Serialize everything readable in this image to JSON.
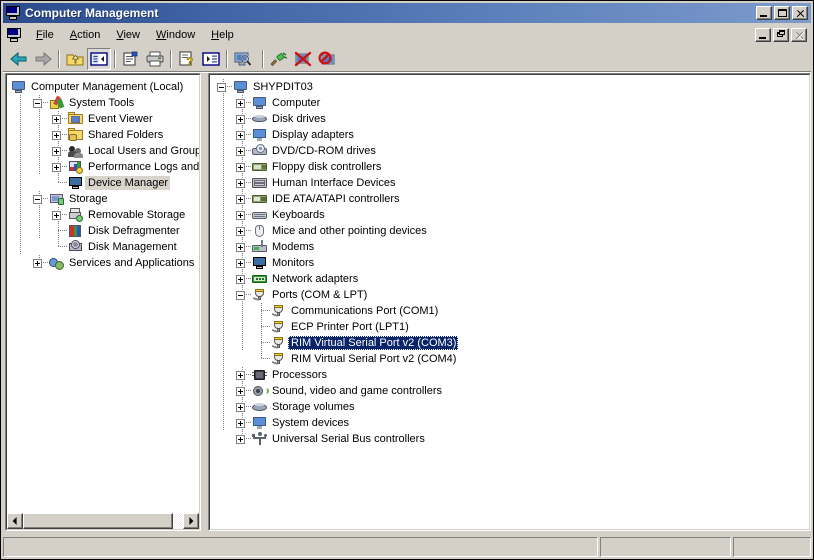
{
  "window": {
    "title": "Computer Management",
    "title_icon": "computer-icon",
    "buttons": {
      "minimize": "minimize-icon",
      "maximize": "maximize-icon",
      "close": "close-icon"
    }
  },
  "mdi": {
    "buttons": {
      "minimize": "minimize-icon",
      "restore": "restore-icon",
      "close": "close-icon-disabled"
    }
  },
  "menu": {
    "system_icon": "console-icon",
    "items": [
      {
        "label": "File",
        "accel": "F"
      },
      {
        "label": "Action",
        "accel": "A"
      },
      {
        "label": "View",
        "accel": "V"
      },
      {
        "label": "Window",
        "accel": "W"
      },
      {
        "label": "Help",
        "accel": "H"
      }
    ]
  },
  "toolbar": {
    "buttons": [
      {
        "name": "back-button",
        "icon": "left-arrow-icon",
        "enabled": true,
        "pressed": false
      },
      {
        "name": "forward-button",
        "icon": "right-arrow-icon",
        "enabled": false,
        "pressed": false
      },
      {
        "name": "up-one-level-button",
        "icon": "up-folder-icon",
        "enabled": true,
        "pressed": false
      },
      {
        "name": "show-hide-tree-button",
        "icon": "console-tree-icon",
        "enabled": true,
        "pressed": true
      },
      {
        "name": "properties-button",
        "icon": "properties-icon",
        "enabled": true,
        "pressed": false
      },
      {
        "name": "print-button",
        "icon": "printer-icon",
        "enabled": true,
        "pressed": false
      },
      {
        "name": "help-button",
        "icon": "help-document-icon",
        "enabled": true,
        "pressed": false
      },
      {
        "name": "show-details-button",
        "icon": "details-pane-icon",
        "enabled": true,
        "pressed": false
      },
      {
        "name": "scan-hardware-changes-button",
        "icon": "scan-hardware-icon",
        "enabled": true,
        "pressed": false
      },
      {
        "name": "update-driver-button",
        "icon": "update-driver-icon",
        "enabled": true,
        "pressed": false
      },
      {
        "name": "uninstall-device-button",
        "icon": "uninstall-red-x-icon",
        "enabled": true,
        "pressed": false
      },
      {
        "name": "disable-device-button",
        "icon": "disable-prohibition-icon",
        "enabled": true,
        "pressed": false
      }
    ]
  },
  "console_tree": {
    "root": {
      "label": "Computer Management (Local)",
      "icon": "computer-icon"
    },
    "nodes": [
      {
        "label": "System Tools",
        "icon": "system-tools-icon",
        "depth": 1,
        "expander": "minus",
        "selected": false
      },
      {
        "label": "Event Viewer",
        "icon": "event-viewer-icon",
        "depth": 2,
        "expander": "plus",
        "selected": false
      },
      {
        "label": "Shared Folders",
        "icon": "shared-folders-icon",
        "depth": 2,
        "expander": "plus",
        "selected": false
      },
      {
        "label": "Local Users and Groups",
        "icon": "local-users-icon",
        "depth": 2,
        "expander": "plus",
        "selected": false
      },
      {
        "label": "Performance Logs and Alerts",
        "icon": "performance-logs-icon",
        "depth": 2,
        "expander": "plus",
        "selected": false
      },
      {
        "label": "Device Manager",
        "icon": "device-manager-icon",
        "depth": 2,
        "expander": "leaf",
        "selected": true
      },
      {
        "label": "Storage",
        "icon": "storage-icon",
        "depth": 1,
        "expander": "minus",
        "selected": false
      },
      {
        "label": "Removable Storage",
        "icon": "removable-storage-icon",
        "depth": 2,
        "expander": "plus",
        "selected": false
      },
      {
        "label": "Disk Defragmenter",
        "icon": "disk-defrag-icon",
        "depth": 2,
        "expander": "leaf",
        "selected": false
      },
      {
        "label": "Disk Management",
        "icon": "disk-management-icon",
        "depth": 2,
        "expander": "leaf",
        "selected": false
      },
      {
        "label": "Services and Applications",
        "icon": "services-apps-icon",
        "depth": 1,
        "expander": "plus",
        "selected": false
      }
    ]
  },
  "device_tree": {
    "root": {
      "label": "SHYPDIT03",
      "icon": "computer-node-icon",
      "expander": "minus"
    },
    "nodes": [
      {
        "label": "Computer",
        "icon": "computer-category-icon",
        "depth": 1,
        "expander": "plus",
        "selected": false
      },
      {
        "label": "Disk drives",
        "icon": "disk-drive-icon",
        "depth": 1,
        "expander": "plus",
        "selected": false
      },
      {
        "label": "Display adapters",
        "icon": "display-adapter-icon",
        "depth": 1,
        "expander": "plus",
        "selected": false
      },
      {
        "label": "DVD/CD-ROM drives",
        "icon": "dvd-drive-icon",
        "depth": 1,
        "expander": "plus",
        "selected": false
      },
      {
        "label": "Floppy disk controllers",
        "icon": "floppy-controller-icon",
        "depth": 1,
        "expander": "plus",
        "selected": false
      },
      {
        "label": "Human Interface Devices",
        "icon": "hid-icon",
        "depth": 1,
        "expander": "plus",
        "selected": false
      },
      {
        "label": "IDE ATA/ATAPI controllers",
        "icon": "ide-controller-icon",
        "depth": 1,
        "expander": "plus",
        "selected": false
      },
      {
        "label": "Keyboards",
        "icon": "keyboard-icon",
        "depth": 1,
        "expander": "plus",
        "selected": false
      },
      {
        "label": "Mice and other pointing devices",
        "icon": "mouse-icon",
        "depth": 1,
        "expander": "plus",
        "selected": false
      },
      {
        "label": "Modems",
        "icon": "modem-icon",
        "depth": 1,
        "expander": "plus",
        "selected": false
      },
      {
        "label": "Monitors",
        "icon": "monitor-icon",
        "depth": 1,
        "expander": "plus",
        "selected": false
      },
      {
        "label": "Network adapters",
        "icon": "network-adapter-icon",
        "depth": 1,
        "expander": "plus",
        "selected": false
      },
      {
        "label": "Ports (COM & LPT)",
        "icon": "port-icon",
        "depth": 1,
        "expander": "minus",
        "selected": false
      },
      {
        "label": "Communications Port (COM1)",
        "icon": "port-icon",
        "depth": 2,
        "expander": "leaf",
        "selected": false
      },
      {
        "label": "ECP Printer Port (LPT1)",
        "icon": "port-icon",
        "depth": 2,
        "expander": "leaf",
        "selected": false
      },
      {
        "label": "RIM Virtual Serial Port v2 (COM3)",
        "icon": "port-icon",
        "depth": 2,
        "expander": "leaf",
        "selected": true
      },
      {
        "label": "RIM Virtual Serial Port v2 (COM4)",
        "icon": "port-icon",
        "depth": 2,
        "expander": "leaf",
        "selected": false
      },
      {
        "label": "Processors",
        "icon": "processor-icon",
        "depth": 1,
        "expander": "plus",
        "selected": false
      },
      {
        "label": "Sound, video and game controllers",
        "icon": "sound-controller-icon",
        "depth": 1,
        "expander": "plus",
        "selected": false
      },
      {
        "label": "Storage volumes",
        "icon": "storage-volume-icon",
        "depth": 1,
        "expander": "plus",
        "selected": false
      },
      {
        "label": "System devices",
        "icon": "system-device-icon",
        "depth": 1,
        "expander": "plus",
        "selected": false
      },
      {
        "label": "Universal Serial Bus controllers",
        "icon": "usb-controller-icon",
        "depth": 1,
        "expander": "plus",
        "selected": false
      }
    ]
  },
  "left_scrollbar": {
    "left_arrow": "scroll-left-arrow-icon",
    "right_arrow": "scroll-right-arrow-icon",
    "thumb_percent": 94
  },
  "statusbar": {
    "panes": [
      "",
      "",
      ""
    ]
  },
  "colors": {
    "title_gradient_start": "#2b4a8b",
    "title_gradient_end": "#7d9bcc",
    "face": "#d4d0c8",
    "selection_active": "#0a246a",
    "selection_inactive": "#d8d4cc",
    "tree_line": "#808080"
  }
}
